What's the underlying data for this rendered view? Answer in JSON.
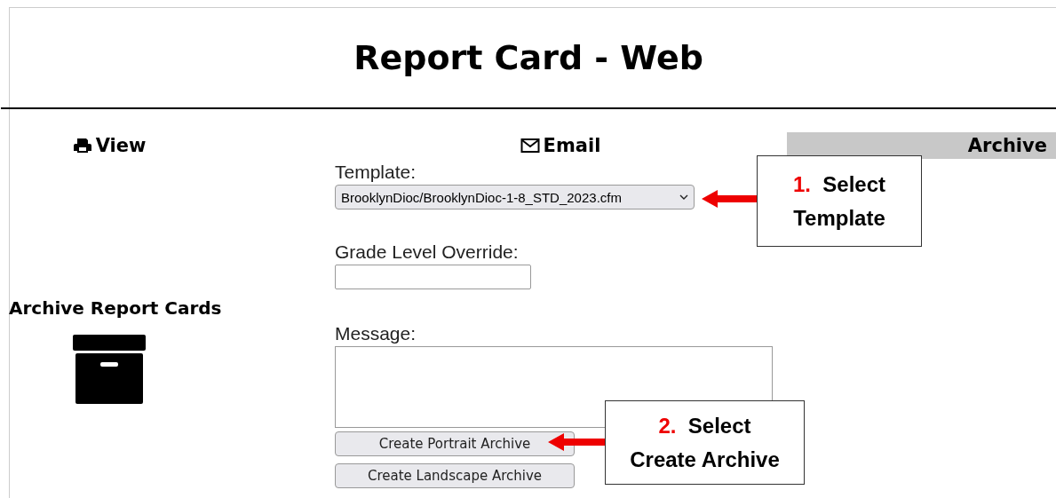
{
  "title": "Report Card - Web",
  "tabs": [
    {
      "label": "View",
      "selected": false
    },
    {
      "label": "Email",
      "selected": false
    },
    {
      "label": "Archive",
      "selected": true
    }
  ],
  "section_title": "Archive Report Cards",
  "form": {
    "template_label": "Template:",
    "template_value": "BrooklynDioc/BrooklynDioc-1-8_STD_2023.cfm",
    "grade_label": "Grade Level Override:",
    "message_label": "Message:",
    "buttons": [
      "Create Portrait Archive",
      "Create Landscape Archive"
    ]
  },
  "callouts": [
    {
      "number": "1.",
      "lines": [
        "Select",
        "Template"
      ]
    },
    {
      "number": "2.",
      "lines": [
        "Select",
        "Create Archive"
      ]
    }
  ]
}
